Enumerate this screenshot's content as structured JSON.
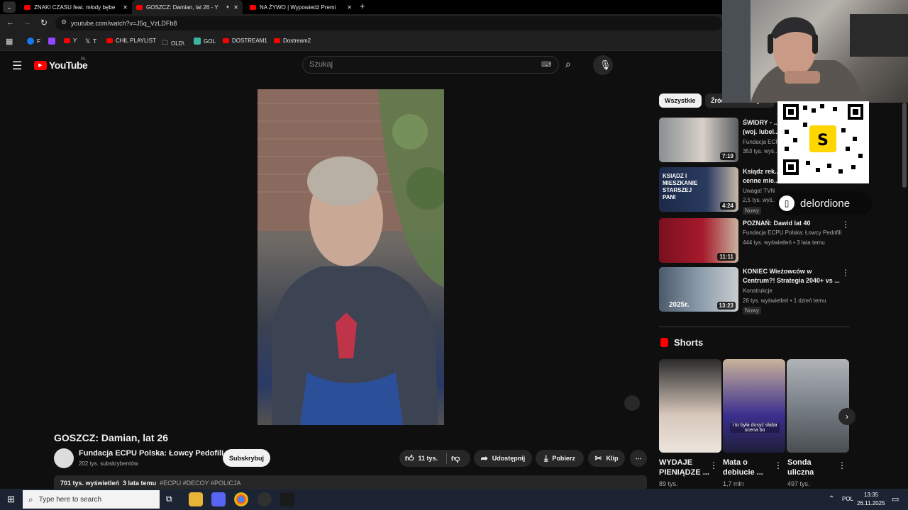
{
  "tabs": [
    {
      "label": "ZNAKI CZASU feat. młody bębe"
    },
    {
      "label": "GOSZCZ: Damian, lat 26 - Y"
    },
    {
      "label": "NA ŻYWO | Wypowiedź Premi"
    }
  ],
  "address": {
    "url": "youtube.com/watch?v=J5q_VzLDFb8"
  },
  "bookmarks": [
    "F",
    "Y",
    "T",
    "CHIL PLAYLIST",
    "OLD\\",
    "GOL",
    "DOSTREAM1",
    "Dostream2"
  ],
  "youtube": {
    "logo_text": "YouTube",
    "region": "PL",
    "search_placeholder": "Szukaj"
  },
  "video": {
    "title": "GOSZCZ: Damian, lat 26",
    "channel": "Fundacja ECPU Polska: Łowcy Pedofili",
    "subscribers": "202 tys. subskrybentów",
    "subscribe_label": "Subskrybuj",
    "likes": "11 tys.",
    "share_label": "Udostępnij",
    "download_label": "Pobierz",
    "clip_label": "Klip",
    "views": "701 tys. wyświetleń",
    "age": "3 lata temu",
    "tags": "#ECPU #DECOY #POLICJA"
  },
  "chips": [
    "Wszystkie",
    "Źródło: Fundacja ECP"
  ],
  "sidebar": [
    {
      "title": "ŚWIDRY - ...",
      "title2": "(woj. lubel...",
      "channel": "Fundacja ECP...",
      "meta": "353 tys. wyś...",
      "duration": "7:19",
      "badge": ""
    },
    {
      "title": "Ksiądz rek...",
      "title2": "cenne mie...",
      "channel": "Uwaga! TVN",
      "meta": "2,5 tys. wyś...",
      "duration": "4:24",
      "badge": "Nowy",
      "thumb_text": "KSIĄDZ I MIESZKANIE STARSZEJ PANI"
    },
    {
      "title": "POZNAŃ: Dawid lat 40",
      "title2": "",
      "channel": "Fundacja ECPU Polska: Łowcy Pedofili",
      "meta": "444 tys. wyświetleń • 3 lata temu",
      "duration": "11:11",
      "badge": ""
    },
    {
      "title": "KONIEC Wieżowców w",
      "title2": "Centrum?! Strategia 2040+ vs ...",
      "channel": "Konstrukcje",
      "meta": "26 tys. wyświetleń • 1 dzień temu",
      "duration": "13:23",
      "badge": "Nowy",
      "thumb_text": "2025r."
    }
  ],
  "shorts": {
    "heading": "Shorts",
    "items": [
      {
        "title": "WYDAJE",
        "title2": "PIENIĄDZE ...",
        "views": "89 tys."
      },
      {
        "title": "Mata o",
        "title2": "debiucie ...",
        "views": "1,7 mln",
        "overlay": "i to była dosyć słaba ocena bo"
      },
      {
        "title": "Sonda",
        "title2": "uliczna",
        "views": "497 tys."
      }
    ]
  },
  "overlay": {
    "handle": "delordione"
  },
  "taskbar": {
    "search_placeholder": "Type here to search",
    "lang": "POL",
    "time": "13:35",
    "date": "26.11.2025"
  }
}
